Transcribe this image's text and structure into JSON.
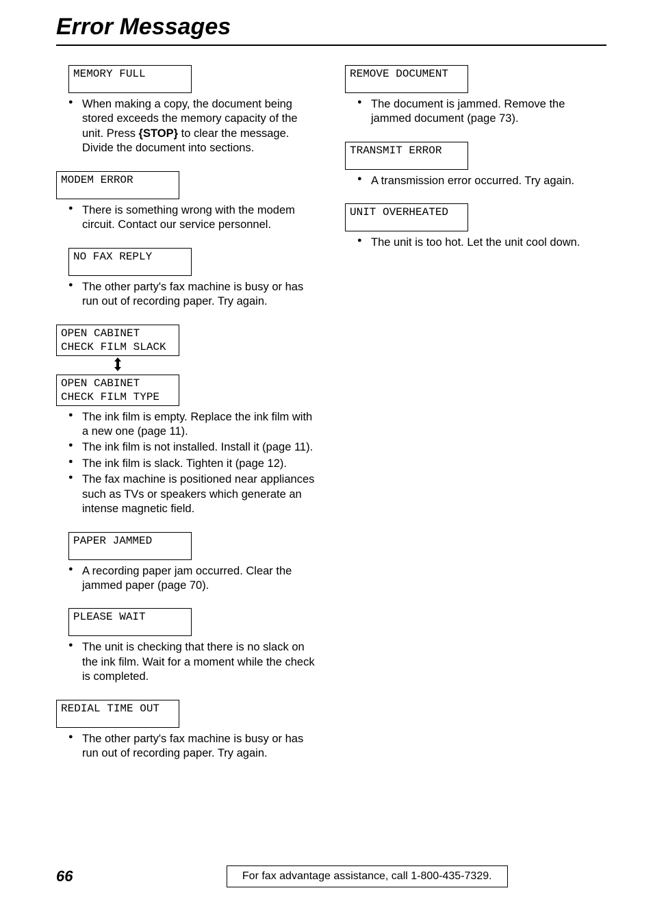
{
  "title": "Error Messages",
  "left": {
    "memory_full": {
      "code": "MEMORY FULL",
      "items": [
        "When making a copy, the document being stored exceeds the memory capacity of the unit. Press |STOP| to clear the message. Divide the document into sections."
      ]
    },
    "modem_error": {
      "code": "MODEM ERROR",
      "items": [
        "There is something wrong with the modem circuit. Contact our service personnel."
      ]
    },
    "no_fax_reply": {
      "code": "NO FAX REPLY",
      "items": [
        "The other party's fax machine is busy or has run out of recording paper. Try again."
      ]
    },
    "open_cabinet": {
      "code1_line1": "OPEN CABINET",
      "code1_line2": "CHECK FILM SLACK",
      "code2_line1": "OPEN CABINET",
      "code2_line2": "CHECK FILM TYPE",
      "items": [
        "The ink film is empty. Replace the ink film with a new one (page 11).",
        "The ink film is not installed. Install it (page 11).",
        "The ink film is slack. Tighten it (page 12).",
        "The fax machine is positioned near appliances such as TVs or speakers which generate an intense magnetic field."
      ]
    },
    "paper_jammed": {
      "code": "PAPER JAMMED",
      "items": [
        "A recording paper jam occurred. Clear the jammed paper (page 70)."
      ]
    },
    "please_wait": {
      "code": "PLEASE WAIT",
      "items": [
        "The unit is checking that there is no slack on the ink film. Wait for a moment while the check is completed."
      ]
    },
    "redial_time_out": {
      "code": "REDIAL TIME OUT",
      "items": [
        "The other party's fax machine is busy or has run out of recording paper. Try again."
      ]
    }
  },
  "right": {
    "remove_document": {
      "code": "REMOVE DOCUMENT",
      "items": [
        "The document is jammed. Remove the jammed document (page 73)."
      ]
    },
    "transmit_error": {
      "code": "TRANSMIT ERROR",
      "items": [
        "A transmission error occurred. Try again."
      ]
    },
    "unit_overheated": {
      "code": "UNIT OVERHEATED",
      "items": [
        "The unit is too hot. Let the unit cool down."
      ]
    }
  },
  "footer": {
    "page_number": "66",
    "assistance": "For fax advantage assistance, call 1-800-435-7329."
  },
  "stop_label": "STOP"
}
